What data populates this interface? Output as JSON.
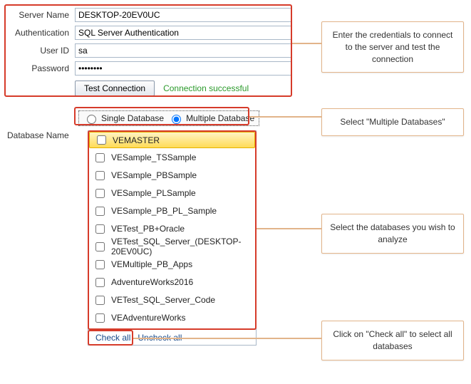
{
  "credentials": {
    "server_name_label": "Server Name",
    "server_name_value": "DESKTOP-20EV0UC",
    "auth_label": "Authentication",
    "auth_value": "SQL Server Authentication",
    "userid_label": "User ID",
    "userid_value": "sa",
    "password_label": "Password",
    "password_value": "••••••••",
    "test_btn": "Test Connection",
    "success_msg": "Connection successful"
  },
  "mode": {
    "single": "Single Database",
    "multiple": "Multiple Database"
  },
  "db_label": "Database Name",
  "databases": [
    "VEMASTER",
    "VESample_TSSample",
    "VESample_PBSample",
    "VESample_PLSample",
    "VESample_PB_PL_Sample",
    "VETest_PB+Oracle",
    "VETest_SQL_Server_(DESKTOP-20EV0UC)",
    "VEMultiple_PB_Apps",
    "AdventureWorks2016",
    "VETest_SQL_Server_Code",
    "VEAdventureWorks"
  ],
  "links": {
    "check_all": "Check all",
    "uncheck_all": "Uncheck all"
  },
  "callouts": {
    "c1": "Enter the credentials to connect to the server and test the connection",
    "c2": "Select \"Multiple Databases\"",
    "c3": "Select the databases you wish to analyze",
    "c4": "Click on \"Check all\" to select all databases"
  }
}
